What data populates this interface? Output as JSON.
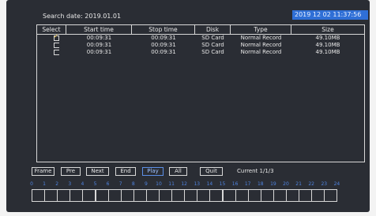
{
  "search": {
    "label": "Search date: 2019.01.01"
  },
  "clock": "2019 12 02 11:37:56",
  "table": {
    "headers": [
      "Select",
      "Start time",
      "Stop time",
      "Disk",
      "Type",
      "Size"
    ],
    "rows": [
      {
        "checked": true,
        "start": "00:09:31",
        "stop": "00:09:31",
        "disk": "SD Card",
        "type": "Normal Record",
        "size": "49.10MB"
      },
      {
        "checked": false,
        "start": "00:09:31",
        "stop": "00:09:31",
        "disk": "SD Card",
        "type": "Normal Record",
        "size": "49.10MB"
      },
      {
        "checked": false,
        "start": "00:09:31",
        "stop": "00:09:31",
        "disk": "SD Card",
        "type": "Normal Record",
        "size": "49.10MB"
      }
    ]
  },
  "buttons": {
    "frame": "Frame",
    "prev": "Pre",
    "next": "Next",
    "end": "End",
    "play": "Play",
    "all": "All",
    "quit": "Quit"
  },
  "current": "Current 1/1/3",
  "timeline": {
    "hours": [
      "0",
      "1",
      "2",
      "3",
      "4",
      "5",
      "6",
      "7",
      "8",
      "9",
      "10",
      "11",
      "12",
      "13",
      "14",
      "15",
      "16",
      "17",
      "18",
      "19",
      "20",
      "21",
      "22",
      "23",
      "24"
    ]
  },
  "colors": {
    "background": "#2a2d34",
    "accent": "#2f6fd6",
    "highlight": "#4f84e0"
  }
}
